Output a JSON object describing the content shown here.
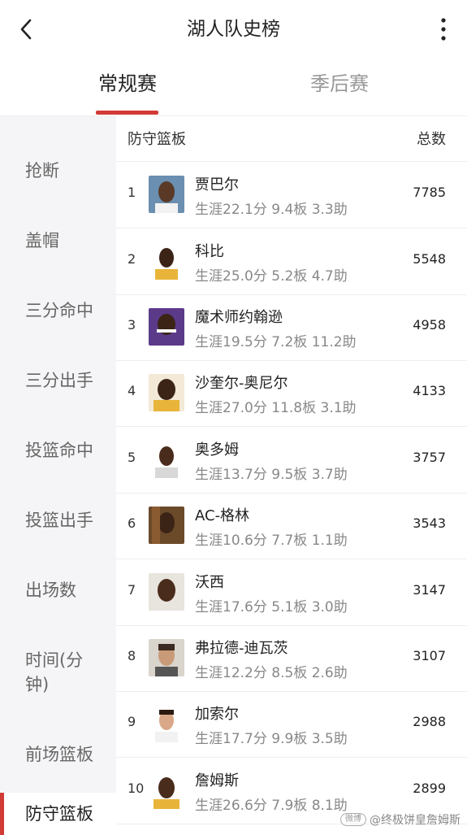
{
  "header": {
    "title": "湖人队史榜"
  },
  "tabs": [
    {
      "label": "常规赛",
      "active": true
    },
    {
      "label": "季后赛",
      "active": false
    }
  ],
  "sidebar": {
    "items": [
      {
        "label": "抢断"
      },
      {
        "label": "盖帽"
      },
      {
        "label": "三分命中"
      },
      {
        "label": "三分出手"
      },
      {
        "label": "投篮命中"
      },
      {
        "label": "投篮出手"
      },
      {
        "label": "出场数"
      },
      {
        "label": "时间(分钟)"
      },
      {
        "label": "前场篮板"
      },
      {
        "label": "防守篮板",
        "active": true
      }
    ]
  },
  "list": {
    "header_left": "防守篮板",
    "header_right": "总数",
    "rows": [
      {
        "rank": "1",
        "name": "贾巴尔",
        "stats": "生涯22.1分  9.4板  3.3助",
        "total": "7785"
      },
      {
        "rank": "2",
        "name": "科比",
        "stats": "生涯25.0分  5.2板  4.7助",
        "total": "5548"
      },
      {
        "rank": "3",
        "name": "魔术师约翰逊",
        "stats": "生涯19.5分  7.2板  11.2助",
        "total": "4958"
      },
      {
        "rank": "4",
        "name": "沙奎尔-奥尼尔",
        "stats": "生涯27.0分  11.8板  3.1助",
        "total": "4133"
      },
      {
        "rank": "5",
        "name": "奥多姆",
        "stats": "生涯13.7分  9.5板  3.7助",
        "total": "3757"
      },
      {
        "rank": "6",
        "name": "AC-格林",
        "stats": "生涯10.6分  7.7板  1.1助",
        "total": "3543"
      },
      {
        "rank": "7",
        "name": "沃西",
        "stats": "生涯17.6分  5.1板  3.0助",
        "total": "3147"
      },
      {
        "rank": "8",
        "name": "弗拉德-迪瓦茨",
        "stats": "生涯12.2分  8.5板  2.6助",
        "total": "3107"
      },
      {
        "rank": "9",
        "name": "加索尔",
        "stats": "生涯17.7分  9.9板  3.5助",
        "total": "2988"
      },
      {
        "rank": "10",
        "name": "詹姆斯",
        "stats": "生涯26.6分  7.9板  8.1助",
        "total": "2899"
      }
    ]
  },
  "watermark": {
    "badge": "微博",
    "text": "@终极饼皇詹姆斯"
  },
  "colors": {
    "accent": "#d23a36",
    "sidebar_bg": "#f5f5f7"
  }
}
